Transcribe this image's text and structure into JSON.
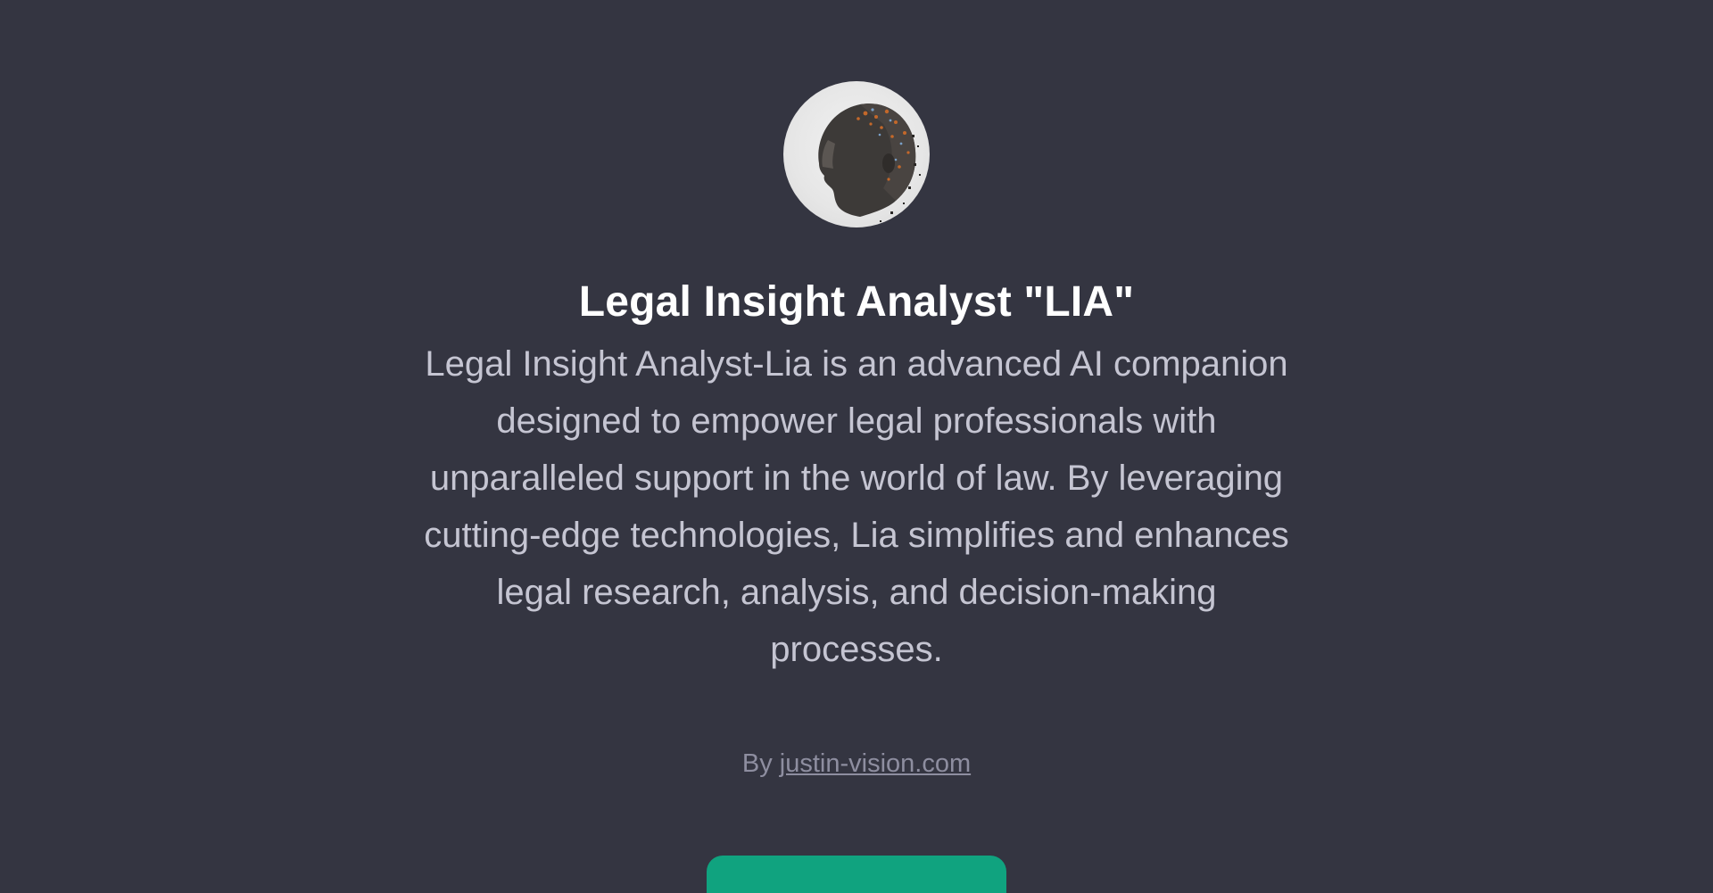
{
  "gpt": {
    "avatar_icon": "digital-head-portrait",
    "title": "Legal Insight Analyst \"LIA\"",
    "description": "Legal Insight Analyst-Lia is an advanced AI companion designed to empower legal professionals with unparalleled support in the world of law. By leveraging cutting-edge technologies, Lia simplifies and enhances legal research, analysis, and decision-making processes.",
    "byline_prefix": "By",
    "author_link": "justin-vision.com"
  },
  "colors": {
    "background": "#343541",
    "title": "#ffffff",
    "description": "#c5c5d2",
    "byline": "#8e8ea0",
    "button": "#10a37f"
  }
}
